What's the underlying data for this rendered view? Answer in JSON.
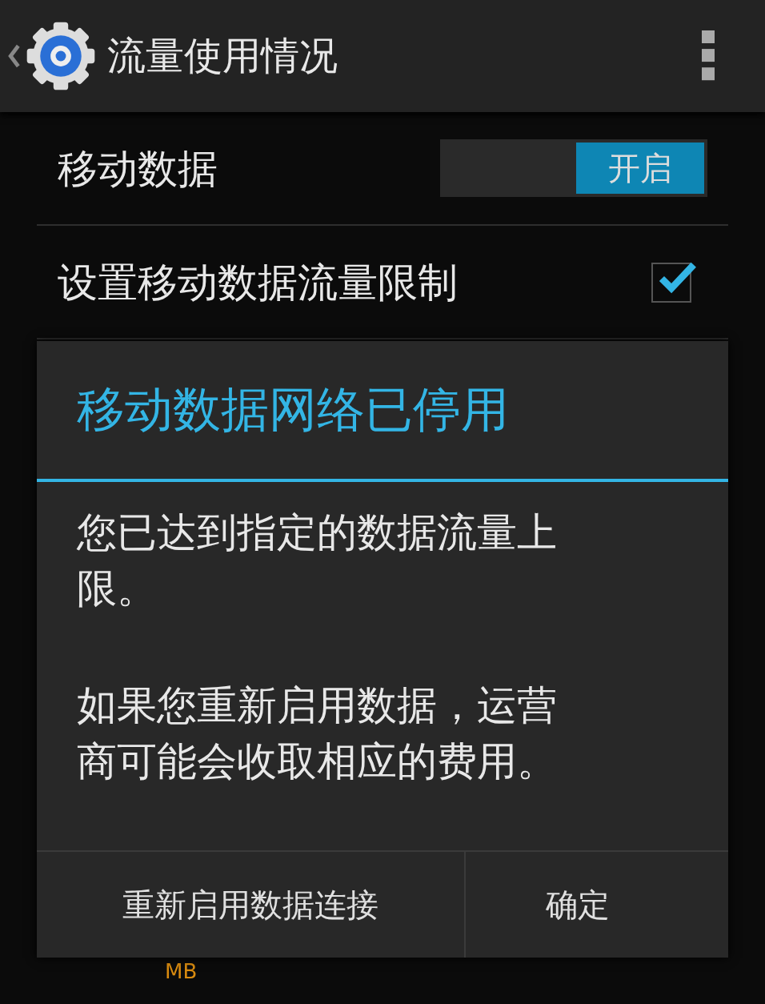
{
  "action_bar": {
    "title": "流量使用情况"
  },
  "settings": [
    {
      "kind": "switch",
      "label": "移动数据",
      "switch_text": "开启",
      "on": true
    },
    {
      "kind": "checkbox",
      "label": "设置移动数据流量限制",
      "checked": true
    }
  ],
  "background": {
    "unit": "MB"
  },
  "dialog": {
    "title": "移动数据网络已停用",
    "paragraphs": [
      "您已达到指定的数据流量上限。",
      "如果您重新启用数据，运营商可能会收取相应的费用。"
    ],
    "buttons": [
      "重新启用数据连接",
      "确定"
    ]
  }
}
